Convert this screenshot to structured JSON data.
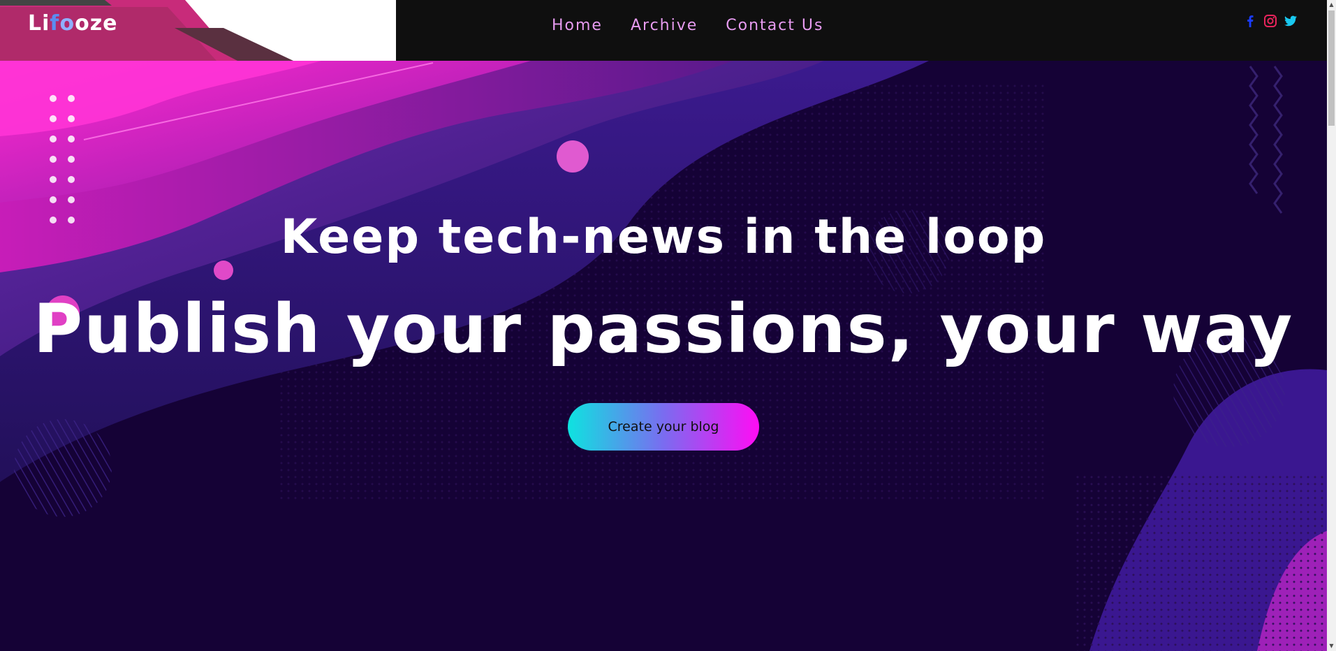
{
  "brand": {
    "letters": [
      "Li",
      "f",
      "o",
      "oze"
    ]
  },
  "nav": {
    "links": [
      "Home",
      "Archive",
      "Contact Us"
    ]
  },
  "socials": [
    "facebook-icon",
    "instagram-icon",
    "twitter-icon"
  ],
  "hero": {
    "tagline": "Keep tech-news in the loop",
    "title": "Publish your passions, your way",
    "cta_label": "Create your blog"
  },
  "colors": {
    "navbar_bg": "#0f0f0f",
    "hero_bg": "#150236",
    "nav_link": "#e79bf0",
    "accent_pink": "#ff2ad0",
    "cta_gradient_start": "#0ee3e0",
    "cta_gradient_end": "#ff0cf4"
  }
}
